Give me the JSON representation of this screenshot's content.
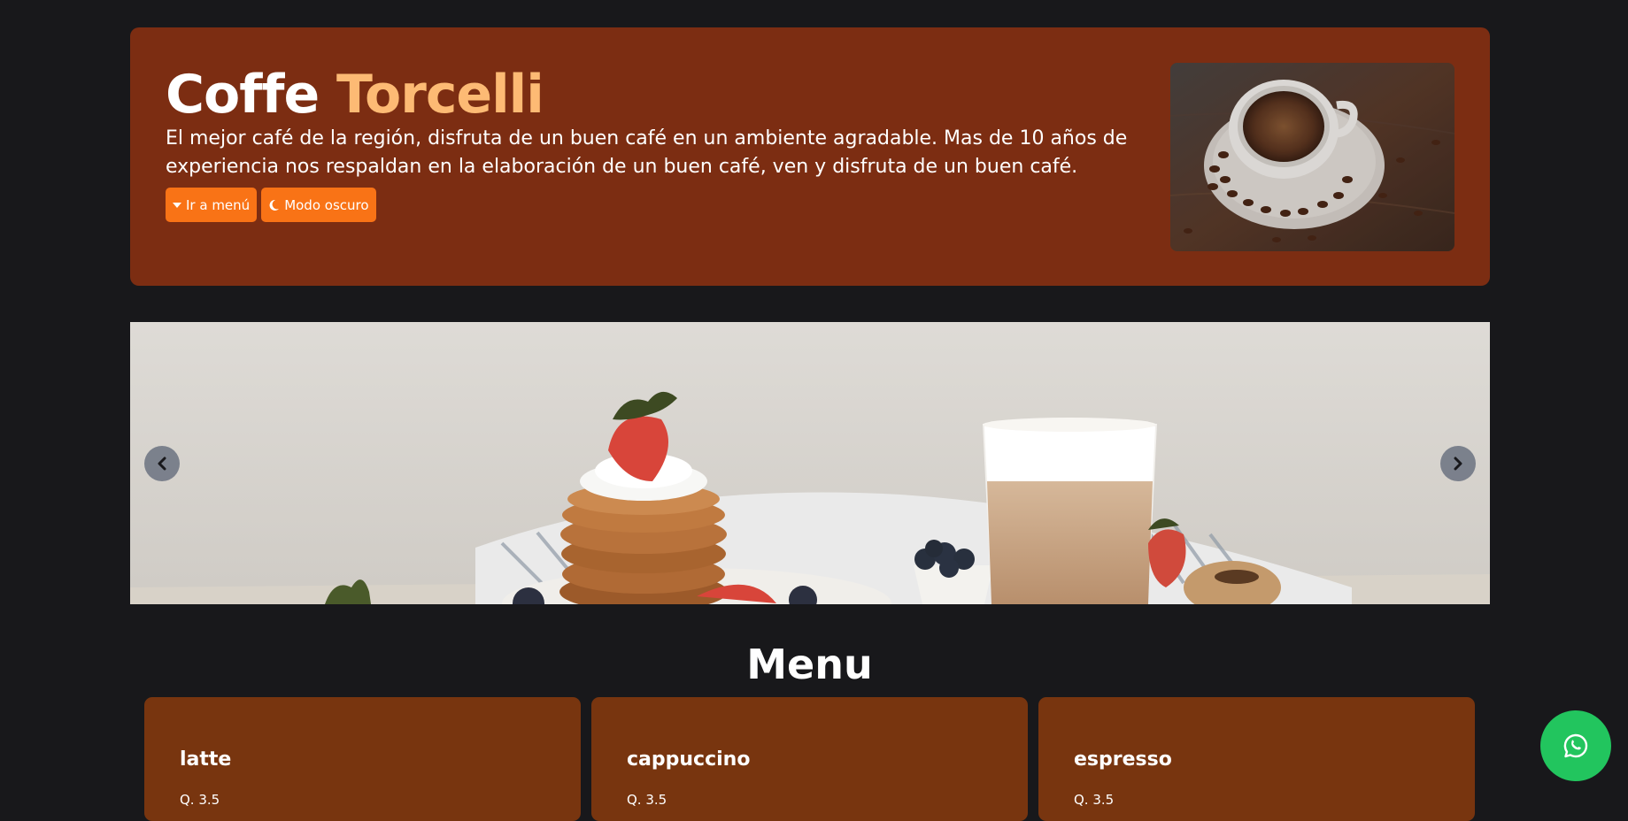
{
  "hero": {
    "title_first": "Coffe",
    "title_accent": "Torcelli",
    "description": "El mejor café de la región, disfruta de un buen café en un ambiente agradable. Mas de 10 años de experiencia nos respaldan en la elaboración de un buen café, ven y disfruta de un buen café.",
    "buttons": {
      "menu_label": "Ir a menú",
      "menu_icon": "caret-down-icon",
      "dark_mode_label": "Modo oscuro",
      "dark_mode_icon": "moon-icon"
    },
    "image_icon": "coffee-cup-photo"
  },
  "carousel": {
    "slide_icon": "pancakes-latte-photo",
    "prev_icon": "chevron-left-icon",
    "next_icon": "chevron-right-icon"
  },
  "menu": {
    "title": "Menu",
    "items": [
      {
        "name": "latte",
        "price": "Q. 3.5"
      },
      {
        "name": "cappuccino",
        "price": "Q. 3.5"
      },
      {
        "name": "espresso",
        "price": "Q. 3.5"
      }
    ]
  },
  "whatsapp": {
    "icon": "whatsapp-icon"
  },
  "colors": {
    "background": "#18181b",
    "hero_bg": "#7c2d12",
    "accent_text": "#fdba74",
    "button_bg": "#f97316",
    "card_bg": "#78350f",
    "whatsapp_bg": "#22c55e"
  }
}
